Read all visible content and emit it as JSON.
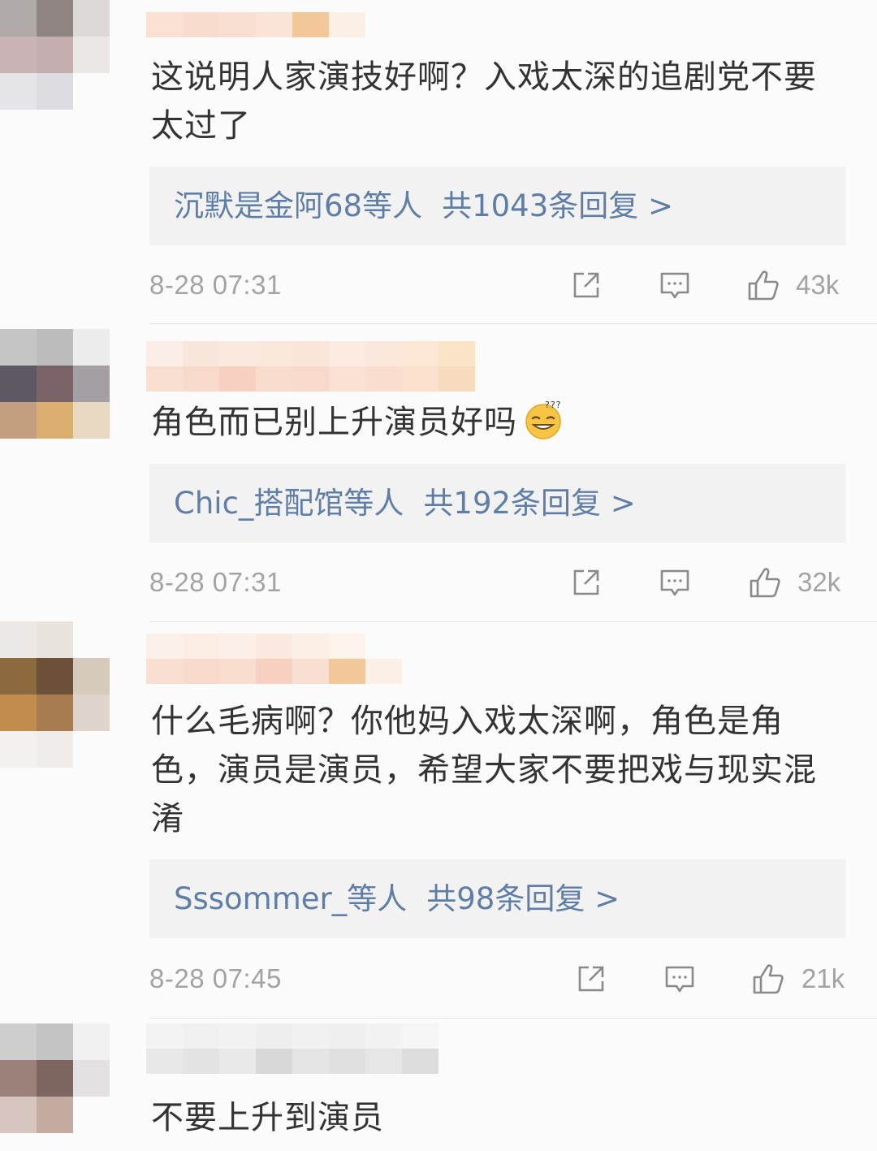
{
  "comments": [
    {
      "text": "这说明人家演技好啊？入戏太深的追剧党不要太过了",
      "reply_users": "沉默是金阿68等人",
      "reply_total": "共1043条回复 >",
      "time": "8-28 07:31",
      "likes": "43k"
    },
    {
      "text": "角色而已别上升演员好吗",
      "reply_users": "Chic_搭配馆等人",
      "reply_total": "共192条回复 >",
      "time": "8-28 07:31",
      "likes": "32k"
    },
    {
      "text": "什么毛病啊？你他妈入戏太深啊，角色是角色，演员是演员，希望大家不要把戏与现实混淆",
      "reply_users": "Sssommer_等人",
      "reply_total": "共98条回复 >",
      "time": "8-28 07:45",
      "likes": "21k"
    },
    {
      "text": "不要上升到演员"
    }
  ],
  "icons": {
    "share": "share-icon",
    "comment": "comment-icon",
    "like": "thumbs-up-icon",
    "emoji": "dizzy-smile-emoji"
  },
  "colors": {
    "background": "#fbfbfb",
    "text": "#333333",
    "link": "#5e7ea8",
    "meta": "#a3a3a3",
    "reply_box": "#f2f2f2"
  }
}
